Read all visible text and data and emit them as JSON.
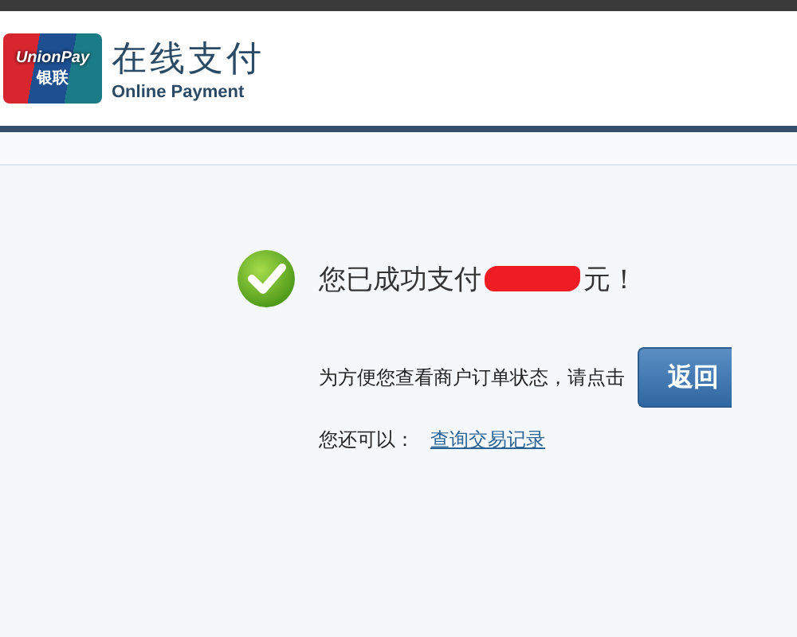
{
  "header": {
    "logo": {
      "brand_en": "UnionPay",
      "brand_cn": "银联"
    },
    "title_cn": "在线支付",
    "title_en": "Online Payment"
  },
  "result": {
    "message_before": "您已成功支付",
    "amount_redacted": true,
    "message_after": "元！",
    "hint": "为方便您查看商户订单状态，请点击",
    "return_button": "返回",
    "also_label": "您还可以：",
    "history_link": "查询交易记录"
  }
}
